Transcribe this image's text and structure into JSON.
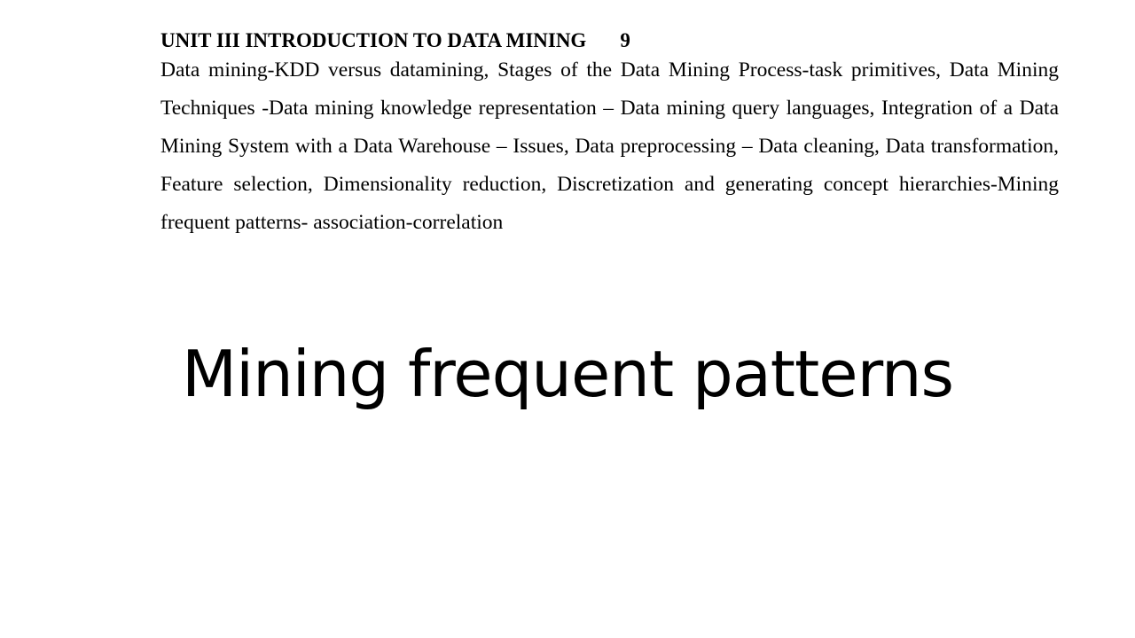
{
  "syllabus": {
    "unit_title": "UNIT III INTRODUCTION TO DATA MINING",
    "unit_hours": "9",
    "content": "Data mining-KDD versus datamining, Stages of the Data Mining Process-task primitives, Data Mining Techniques -Data mining knowledge representation – Data mining query languages, Integration of a Data Mining System with a Data Warehouse – Issues, Data preprocessing – Data cleaning, Data transformation, Feature selection, Dimensionality reduction, Discretization and generating concept hierarchies-Mining frequent patterns- association-correlation"
  },
  "slide": {
    "title": "Mining frequent patterns"
  }
}
